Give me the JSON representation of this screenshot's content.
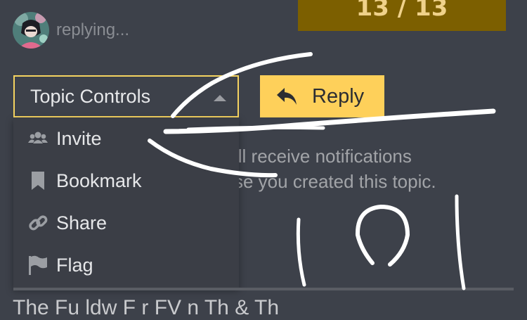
{
  "progress": {
    "text": "13 / 13"
  },
  "composer": {
    "status_text": "replying..."
  },
  "topic_controls": {
    "label": "Topic Controls"
  },
  "reply": {
    "label": "Reply"
  },
  "notification": {
    "lines": [
      "ill receive notifications",
      "se you created this topic."
    ]
  },
  "menu": {
    "items": [
      {
        "label": "Invite",
        "icon": "users-icon"
      },
      {
        "label": "Bookmark",
        "icon": "bookmark-icon"
      },
      {
        "label": "Share",
        "icon": "link-icon"
      },
      {
        "label": "Flag",
        "icon": "flag-icon"
      }
    ]
  },
  "footer": {
    "cutoff_text": "The Fu   ldw  F r  FV  n  Th       & Th"
  },
  "colors": {
    "background": "#3d414a",
    "accent": "#fed05a",
    "progress_bg": "#7c5f00",
    "menu_bg": "#3b3e46"
  }
}
